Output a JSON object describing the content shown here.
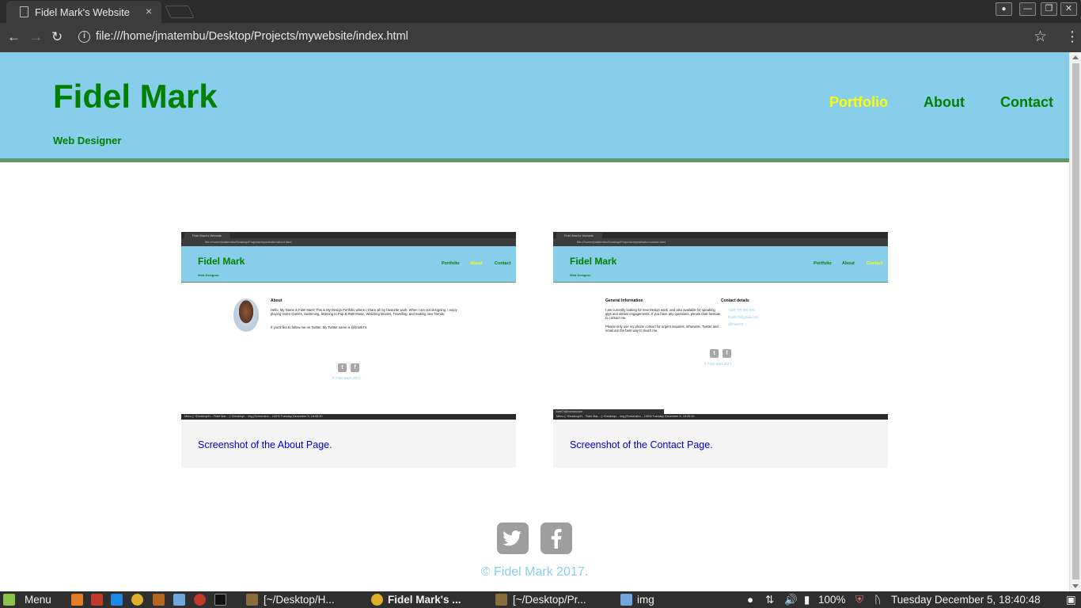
{
  "browser": {
    "tab_title": "Fidel Mark's Website",
    "tab_close": "×",
    "url": "file:///home/jmatembu/Desktop/Projects/mywebsite/index.html",
    "win_minimize": "—",
    "win_restore": "❐",
    "win_close": "✕"
  },
  "site": {
    "title": "Fidel Mark",
    "subtitle": "Web Designer",
    "nav": [
      {
        "label": "Portfolio",
        "color": "#ffff00",
        "active": true
      },
      {
        "label": "About",
        "color": "#008000",
        "active": false
      },
      {
        "label": "Contact",
        "color": "#008000",
        "active": false
      }
    ],
    "header_bg": "#87ceeb",
    "accent": "#008000"
  },
  "portfolio": [
    {
      "caption": "Screenshot of the About Page.",
      "mini": {
        "tab": "Fidel Mark's Website",
        "url": "file:///home/jmatembu/Desktop/Projects/mywebsite/about.html",
        "title": "Fidel Mark",
        "subtitle": "Web Designer",
        "nav": [
          "Portfolio",
          "About",
          "Contact"
        ],
        "heading": "About",
        "body": "Hello, My Name is Fidel Mark! This is My Design Portfolio where I share all my favourite work. When I am not designing, I enjoy playing Video Games, Swimming, listening to Pop & R&B Music, Watching Movies, Travelling, and making new friends.",
        "body2": "If you'd like to follow me on Twitter, My Twitter name is @fmark74.",
        "copy": "© Fidel Mark 2017.",
        "taskbar": "Menu   [~/Desktop/H...   Fidel Mar...   [~/Desktop/...   img   [Screensho...   100%   Tuesday December  5, 18:35:30"
      }
    },
    {
      "caption": "Screenshot of the Contact Page.",
      "mini": {
        "tab": "Fidel Mark's Website",
        "url": "file:///home/jmatembu/Desktop/Projects/mywebsite/contact.html",
        "title": "Fidel Mark",
        "subtitle": "Web Designer",
        "nav": [
          "Portfolio",
          "About",
          "Contact"
        ],
        "heading": "General Information",
        "body": "I am currently looking for new Design work, and also available for speaking gigs and similar engagements. If you have any questions, please dont hesitate to contact me.",
        "body2": "Please only use my phone contact for urgent inquiries, otherwise, Twitter and email are the best way to reach me.",
        "heading2": "Contact details",
        "details": [
          "+256 776 000 000",
          "fmark74@gmail.com",
          "@fmark74"
        ],
        "copy": "© Fidel Mark 2017.",
        "status": "mark74@hotmail.com",
        "taskbar": "Menu   [~/Desktop/H...   Fidel Mar...   [~/Desktop/...   img   [Screensho...   100%   Tuesday December  5, 18:35:20"
      }
    }
  ],
  "footer": {
    "twitter_glyph": "🐦",
    "facebook_glyph": "f",
    "copyright": "© Fidel Mark 2017."
  },
  "taskbar": {
    "menu": "Menu",
    "windows": [
      "[~/Desktop/H...",
      "Fidel Mark's ...",
      "[~/Desktop/Pr...",
      "img"
    ],
    "battery": "100%",
    "clock": "Tuesday December  5, 18:40:48"
  }
}
